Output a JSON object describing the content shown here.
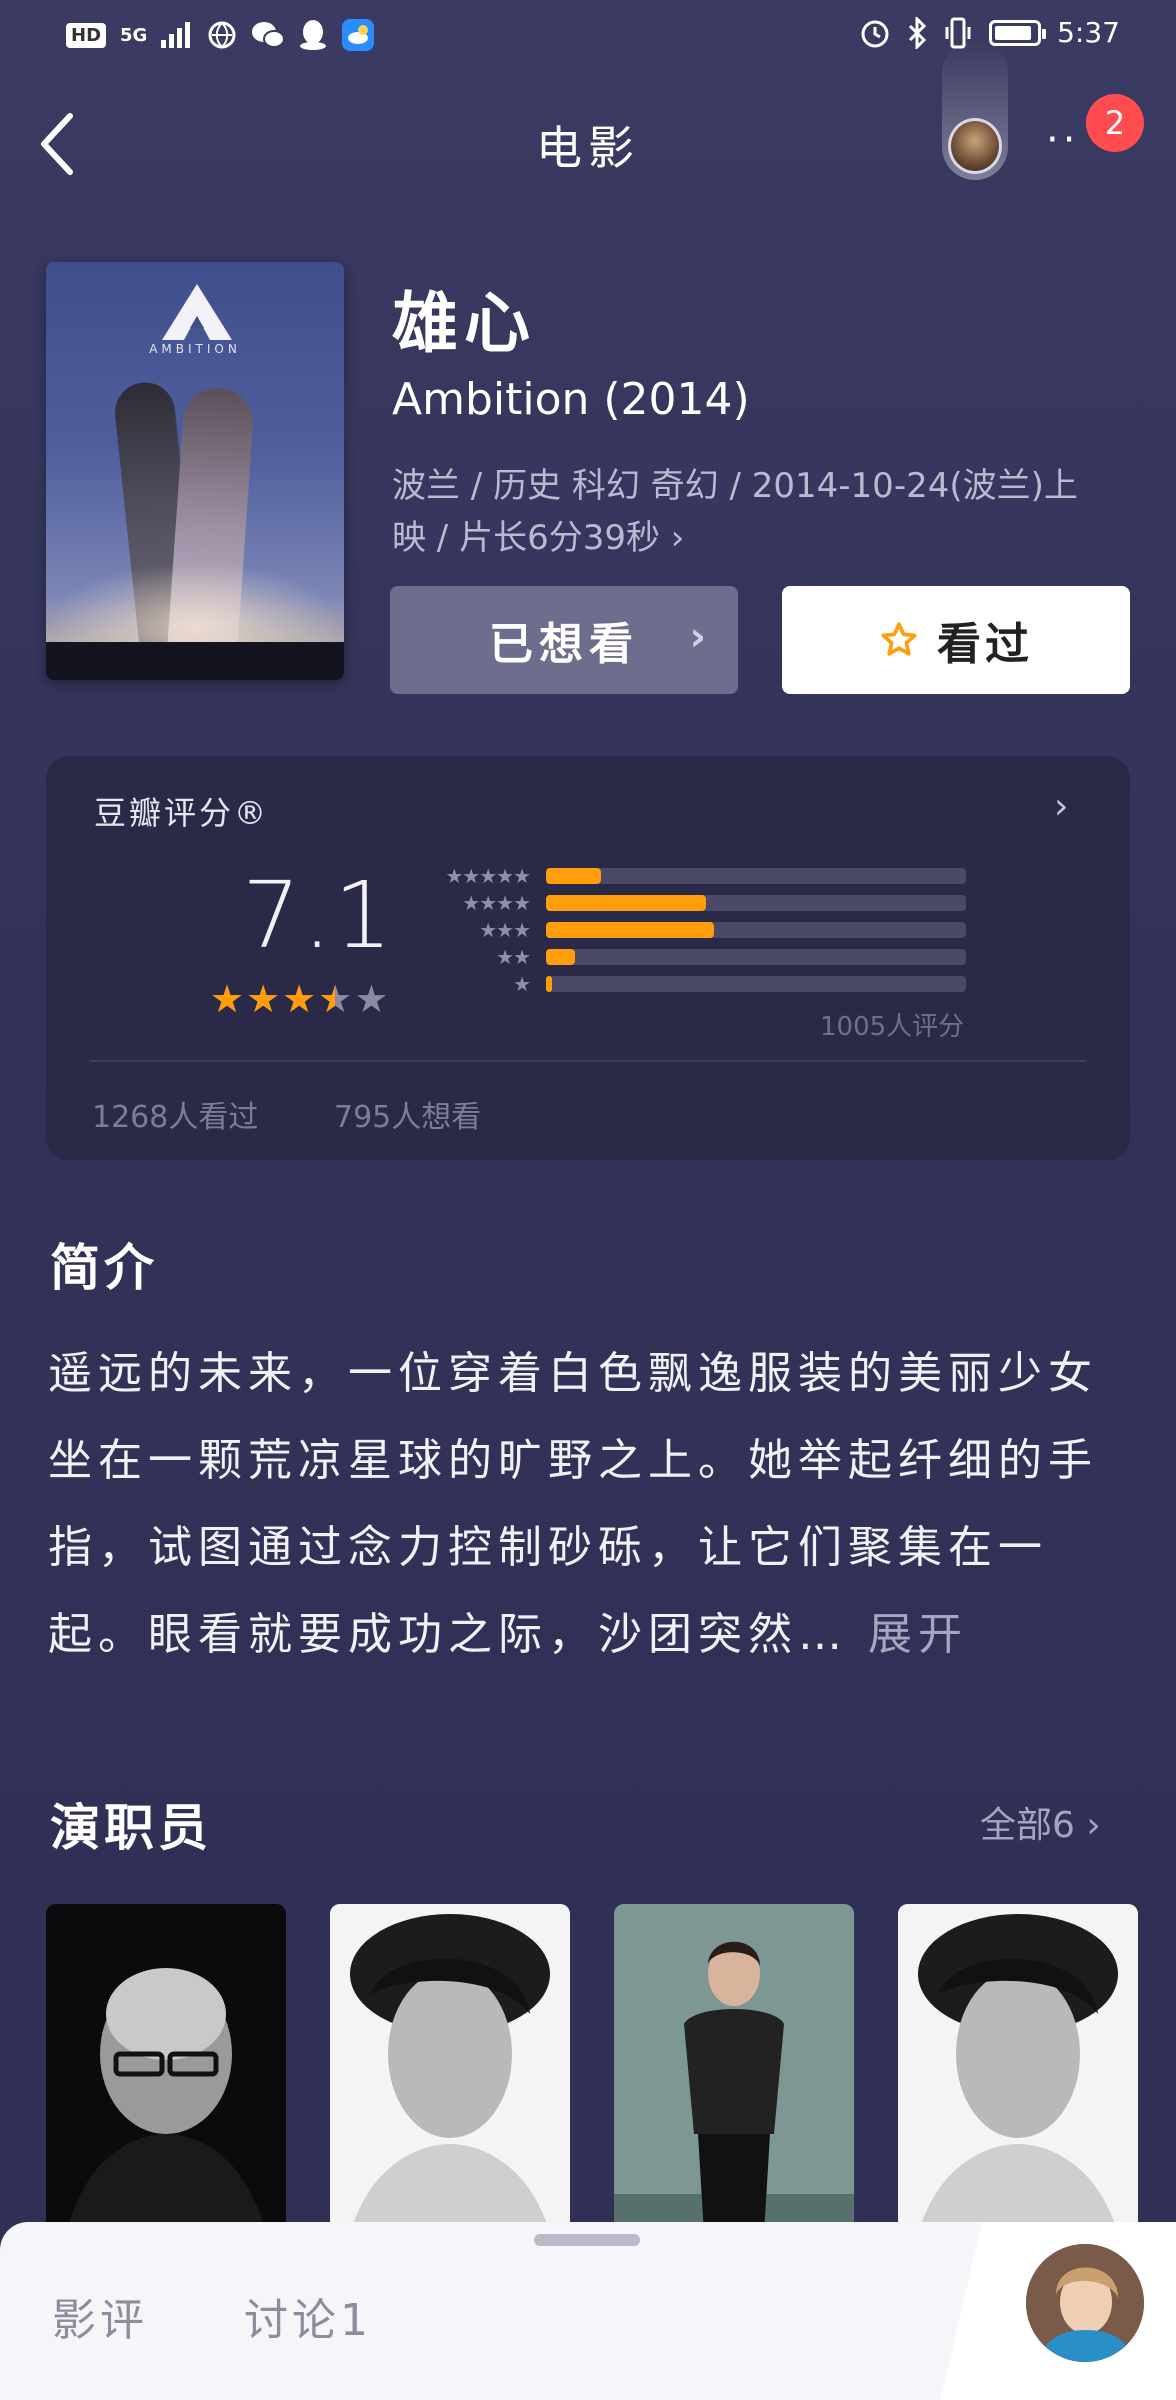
{
  "status_bar": {
    "hd": "HD",
    "network": "5G",
    "time": "5:37"
  },
  "nav": {
    "title": "电影",
    "notification_count": "2",
    "more_label": "··"
  },
  "movie": {
    "title_cn": "雄心",
    "title_en": "Ambition (2014)",
    "meta_line1": "波兰 / 历史 科幻 奇幻 / 2014-10-24(波兰)上",
    "meta_line2": "映 / 片长6分39秒 ›",
    "poster_text": "AMBITION"
  },
  "actions": {
    "want_label": "已想看",
    "seen_label": "看过"
  },
  "rating": {
    "label": "豆瓣评分®",
    "score": "7.1",
    "stars_value": 3.5,
    "distribution": [
      {
        "stars": 5,
        "fraction": 0.13
      },
      {
        "stars": 4,
        "fraction": 0.38
      },
      {
        "stars": 3,
        "fraction": 0.4
      },
      {
        "stars": 2,
        "fraction": 0.07
      },
      {
        "stars": 1,
        "fraction": 0.015
      }
    ],
    "ratings_count": "1005人评分",
    "seen_count": "1268人看过",
    "want_count": "795人想看"
  },
  "intro": {
    "title": "简介",
    "text": "遥远的未来，一位穿着白色飘逸服装的美丽少女坐在一颗荒凉星球的旷野之上。她举起纤细的手指，试图通过念力控制砂砾，让它们聚集在一起。眼看就要成功之际，沙团突然…",
    "expand_label": "展开"
  },
  "cast": {
    "title": "演职员",
    "all_label": "全部6 ›"
  },
  "bottom_sheet": {
    "tab_review": "影评",
    "tab_discuss": "讨论1"
  },
  "colors": {
    "background": "#35355c",
    "accent_orange": "#ff9d0a",
    "badge_red": "#ff4d4f",
    "card": "#2a2a48"
  }
}
